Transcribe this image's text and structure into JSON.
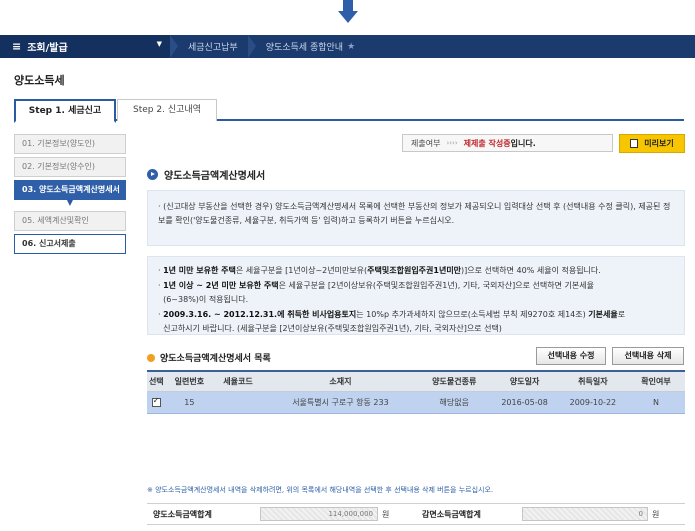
{
  "top_arrow_icon": "down-arrow-icon",
  "nav": {
    "main_menu": "조회/발급",
    "crumbs": [
      "세금신고납부",
      "양도소득세 종합안내"
    ],
    "star_icon": "star-icon"
  },
  "page_title": "양도소득세",
  "tabs": [
    "Step 1. 세금신고",
    "Step 2. 신고내역"
  ],
  "sidebar": {
    "items": [
      "01. 기본정보(양도인)",
      "02. 기본정보(양수인)",
      "03. 양도소득금액계산명세서",
      "05. 세액계산및확인",
      "06. 신고서제출"
    ]
  },
  "status": {
    "label": "제출여부",
    "dots": "››››",
    "value_red": "제제출 작성중",
    "value_suffix": "입니다."
  },
  "preview_button": "미리보기",
  "section_title": "양도소득금액계산명세서",
  "info1": "(신고대상 부동산을 선택한 경우) 양도소득금액계산명세서 목록에 선택한 부동산의 정보가 제공되오니 입력대상 선택 후 (선택내용 수정 클릭), 제공된 정보를 확인('양도물건종류, 세율구분, 취득가액 등' 입력)하고 등록하기 버튼을 누르십시오.",
  "info2": {
    "l1_a": "1년 미만 보유한 주택",
    "l1_b": "은 세율구분을 [1년이상~2년미만보유(",
    "l1_c": "주택및조합원입주권1년미만",
    ")으로 선택하면 40% 세율이 적용됩니다.": "",
    "l1_d": ")]으로 선택하면 40% 세율이 적용됩니다.",
    "l2_a": "1년 이상 ~ 2년 미만 보유한 주택",
    "l2_b": "은 세율구분을 [2년이상보유(주택및조합원입주권1년), 기타, 국외자산]으로 선택하면 기본세율",
    "l2_c": "(6~38%)이 적용됩니다.",
    "l3_a": "2009.3.16. ~ 2012.12.31.에 취득한 비사업용토지",
    "l3_b": "는 10%p 추가과세하지 않으므로(소득세법 부칙 제9270호 제14조)",
    "l3_c": "기본세율",
    "l3_d": "로",
    "l4": "신고하시기 바랍니다. (세율구분을 [2년이상보유(주택및조합원입주권1년), 기타, 국외자산]으로 선택)"
  },
  "list_title": "양도소득금액계산명세서 목록",
  "btn_edit": "선택내용 수정",
  "btn_delete": "선택내용 삭제",
  "table": {
    "headers": [
      "선택",
      "일련번호",
      "세율코드",
      "소재지",
      "양도물건종류",
      "양도일자",
      "취득일자",
      "확인여부"
    ],
    "rows": [
      {
        "no": "15",
        "rate_code": "",
        "address": "서울특별시 구로구 항동 233",
        "kind": "해당없음",
        "transfer_date": "2016-05-08",
        "acquire_date": "2009-10-22",
        "confirmed": "N",
        "checked": true
      }
    ]
  },
  "note": "※ 양도소득금액계산명세서 내역을 삭제하려면, 위의 목록에서 해당내역을 선택한 후 선택내용 삭제 버튼을 누르십시오.",
  "totals": {
    "sum_label": "양도소득금액합계",
    "sum_value": "114,000,000",
    "unit": "원",
    "reduce_label": "감면소득금액합계",
    "reduce_value": "0"
  }
}
